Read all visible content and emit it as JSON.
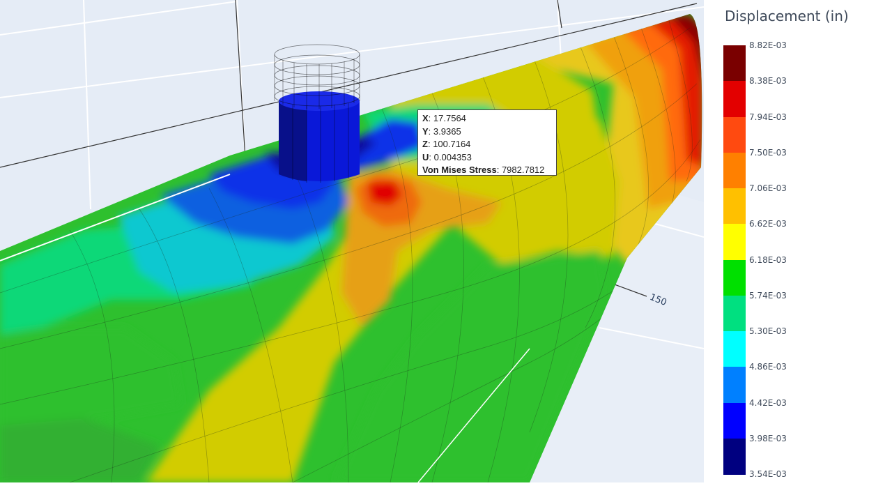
{
  "chart_data": {
    "type": "other",
    "title": "",
    "colorbar": {
      "title": "Displacement (in)",
      "ticks": [
        "8.82E-03",
        "8.38E-03",
        "7.94E-03",
        "7.50E-03",
        "7.06E-03",
        "6.62E-03",
        "6.18E-03",
        "5.74E-03",
        "5.30E-03",
        "4.86E-03",
        "4.42E-03",
        "3.98E-03",
        "3.54E-03"
      ],
      "range": [
        0.00354,
        0.00882
      ],
      "colors": [
        "#7a0000",
        "#e30000",
        "#ff4a10",
        "#ff8000",
        "#ffc000",
        "#ffff00",
        "#00e000",
        "#00e080",
        "#00ffff",
        "#0080ff",
        "#0000ff",
        "#000080"
      ]
    },
    "axis_tick_labels": [
      "150"
    ],
    "tooltip": {
      "rows": [
        {
          "key": "X",
          "value": "17.7564"
        },
        {
          "key": "Y",
          "value": "3.9365"
        },
        {
          "key": "Z",
          "value": "100.7164"
        },
        {
          "key": "U",
          "value": "0.004353"
        },
        {
          "key": "Von Mises Stress",
          "value": "7982.7812"
        }
      ]
    }
  }
}
